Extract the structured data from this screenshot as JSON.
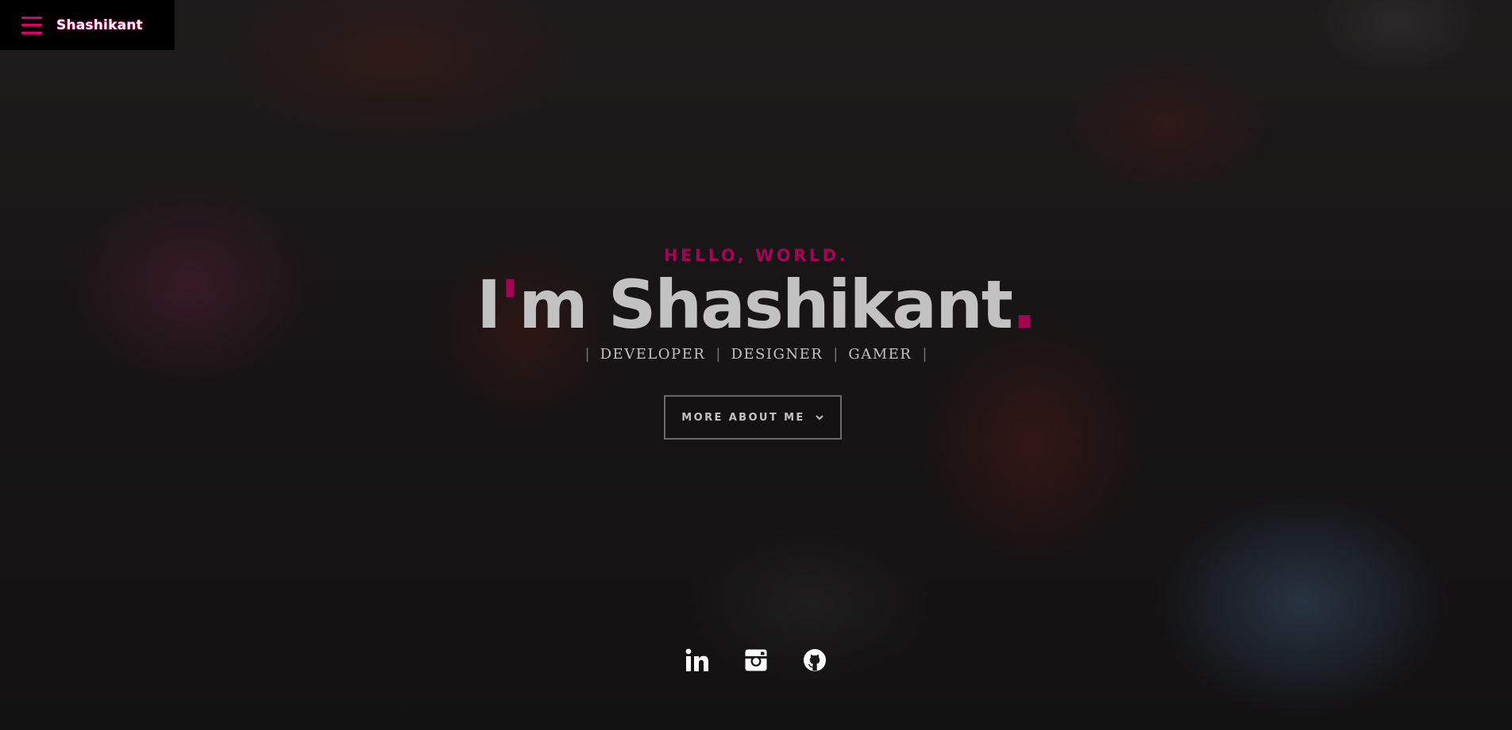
{
  "header": {
    "brand": "Shashikant",
    "menu_icon": "hamburger-menu-icon"
  },
  "intro": {
    "greeting": "HELLO, WORLD.",
    "headline_prefix": "I",
    "headline_apostrophe": "'",
    "headline_rest": "m Shashikant",
    "headline_period": ".",
    "roles": [
      "DEVELOPER",
      "DESIGNER",
      "GAMER"
    ],
    "separator": "|"
  },
  "cta": {
    "label": "MORE ABOUT ME",
    "icon": "chevron-down-icon"
  },
  "social": [
    {
      "name": "linkedin-icon"
    },
    {
      "name": "instagram-icon"
    },
    {
      "name": "github-icon"
    }
  ],
  "colors": {
    "accent": "#d8006e",
    "text": "#ffffff",
    "topbar": "#000000"
  }
}
